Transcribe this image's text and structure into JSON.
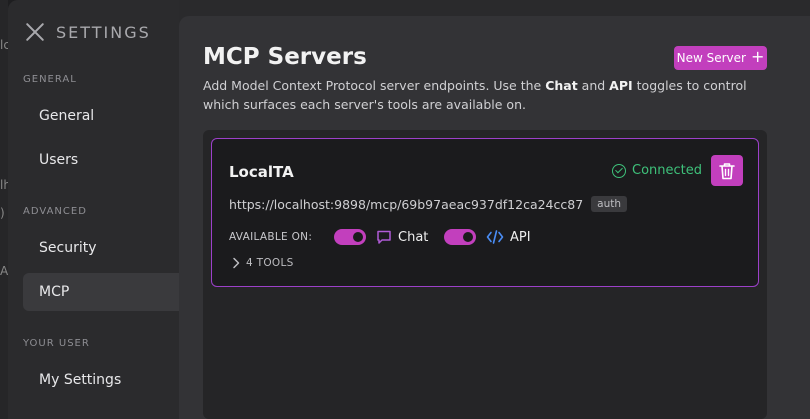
{
  "background_fragments": [
    "lc",
    "lh",
    ")",
    "A"
  ],
  "sidebar": {
    "title": "SETTINGS",
    "sections": [
      {
        "label": "GENERAL",
        "items": [
          {
            "label": "General"
          },
          {
            "label": "Users"
          }
        ]
      },
      {
        "label": "ADVANCED",
        "items": [
          {
            "label": "Security"
          },
          {
            "label": "MCP",
            "active": true
          }
        ]
      },
      {
        "label": "YOUR USER",
        "items": [
          {
            "label": "My Settings"
          }
        ]
      }
    ]
  },
  "main": {
    "title": "MCP Servers",
    "new_server_label": "New Server",
    "description": {
      "part1": "Add Model Context Protocol server endpoints. Use the ",
      "chat": "Chat",
      "and": " and ",
      "api": "API",
      "part2": " toggles to control which surfaces each server's tools are available on."
    },
    "servers": [
      {
        "name": "LocalTA",
        "status": "Connected",
        "url": "https://localhost:9898/mcp/69b97aeac937df12ca24cc87",
        "badge": "auth",
        "available_on_label": "AVAILABLE ON:",
        "chat_label": "Chat",
        "api_label": "API",
        "chat_enabled": true,
        "api_enabled": true,
        "tools_label": "4 TOOLS"
      }
    ]
  },
  "colors": {
    "accent": "#c23fbd",
    "card_border": "#9c40c9",
    "connected": "#3ec17a",
    "api_icon": "#4a8df5"
  }
}
